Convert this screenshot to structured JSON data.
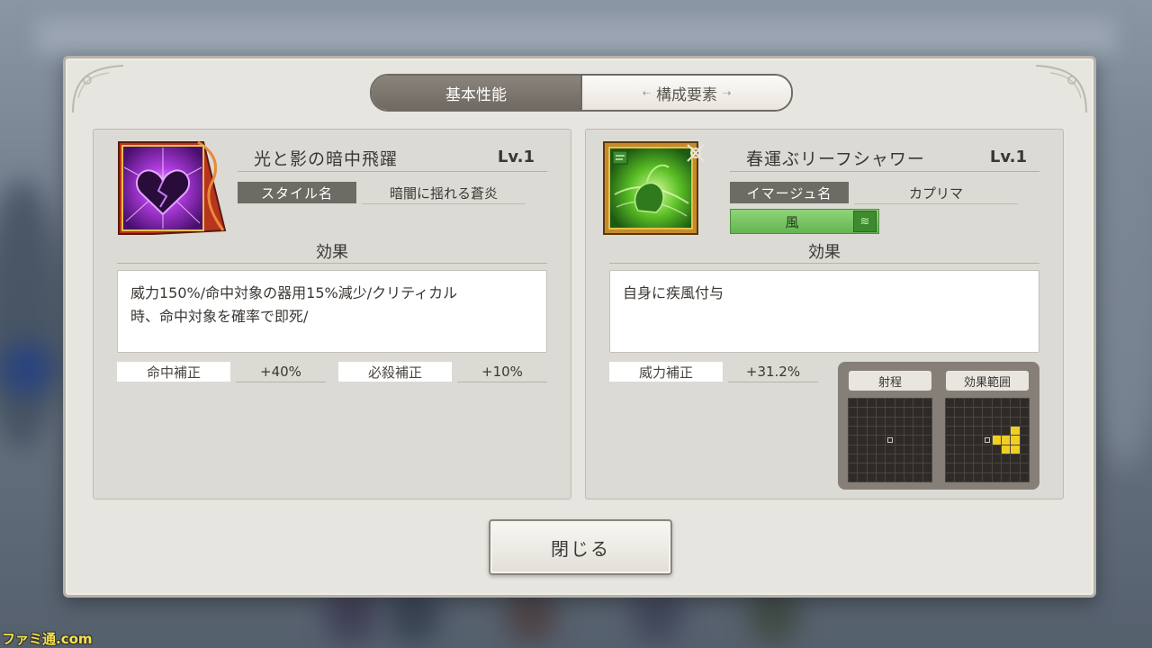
{
  "tabs": {
    "basic": "基本性能",
    "components": "構成要素"
  },
  "left_card": {
    "name": "光と影の暗中飛躍",
    "level": "Lv.1",
    "tag_label": "スタイル名",
    "tag_value": "暗闇に揺れる蒼炎",
    "effect_heading": "効果",
    "effect_text_line1": "威力150%/命中対象の器用15%減少/クリティカル",
    "effect_text_line2": "時、命中対象を確率で即死/",
    "stats": [
      {
        "label": "命中補正",
        "value": "+40%"
      },
      {
        "label": "必殺補正",
        "value": "+10%"
      }
    ],
    "icon": "heart-shatter-icon",
    "icon_color": "#9b2fd0"
  },
  "right_card": {
    "name": "春運ぶリーフシャワー",
    "level": "Lv.1",
    "tag_label": "イマージュ名",
    "tag_value": "カプリマ",
    "element": "風",
    "effect_heading": "効果",
    "effect_text": "自身に疾風付与",
    "stats": [
      {
        "label": "威力補正",
        "value": "+31.2%"
      }
    ],
    "range": {
      "range_label": "射程",
      "area_label": "効果範囲"
    },
    "icon": "wind-leaf-icon",
    "icon_color": "#56c22c"
  },
  "close_label": "閉じる",
  "watermark": "ファミ通.com"
}
